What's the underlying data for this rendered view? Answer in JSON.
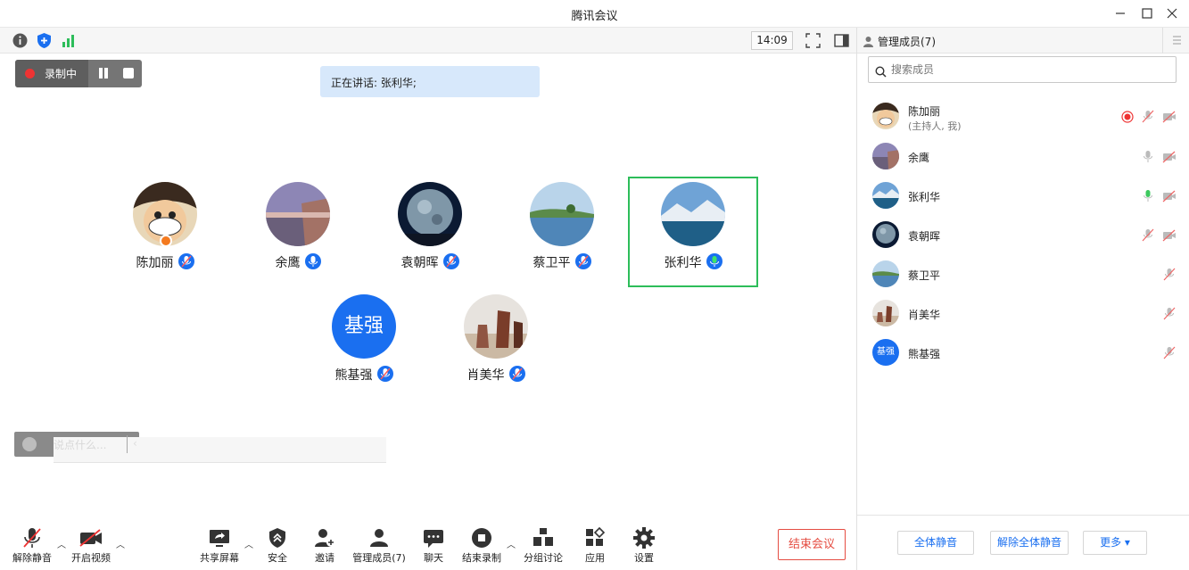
{
  "window": {
    "title": "腾讯会议"
  },
  "topbar": {
    "clock": "14:09"
  },
  "recording": {
    "label": "录制中"
  },
  "speaking": {
    "text": "正在讲话: 张利华;"
  },
  "participants": [
    {
      "name": "陈加丽",
      "mic": "muted",
      "host": true
    },
    {
      "name": "余鹰",
      "mic": "on"
    },
    {
      "name": "袁朝晖",
      "mic": "muted"
    },
    {
      "name": "蔡卫平",
      "mic": "muted"
    },
    {
      "name": "张利华",
      "mic": "speaking",
      "active": true
    },
    {
      "name": "熊基强",
      "mic": "muted",
      "avatar_text": "基强"
    },
    {
      "name": "肖美华",
      "mic": "muted"
    }
  ],
  "chat": {
    "placeholder": "说点什么..."
  },
  "bottombar": {
    "unmute": "解除静音",
    "video": "开启视频",
    "share": "共享屏幕",
    "security": "安全",
    "invite": "邀请",
    "members": "管理成员(7)",
    "chat": "聊天",
    "end_record": "结束录制",
    "breakout": "分组讨论",
    "apps": "应用",
    "settings": "设置",
    "end_meeting": "结束会议"
  },
  "panel": {
    "title": "管理成员(7)",
    "search_placeholder": "搜索成员",
    "members": [
      {
        "name": "陈加丽",
        "sub": "(主持人, 我)"
      },
      {
        "name": "余鹰"
      },
      {
        "name": "张利华"
      },
      {
        "name": "袁朝晖"
      },
      {
        "name": "蔡卫平"
      },
      {
        "name": "肖美华"
      },
      {
        "name": "熊基强",
        "avatar_text": "基强"
      }
    ],
    "mute_all": "全体静音",
    "unmute_all": "解除全体静音",
    "more": "更多 ▾"
  },
  "colors": {
    "accent": "#1a6ff0",
    "speaking": "#2dbd5a",
    "end": "#e54d42"
  }
}
